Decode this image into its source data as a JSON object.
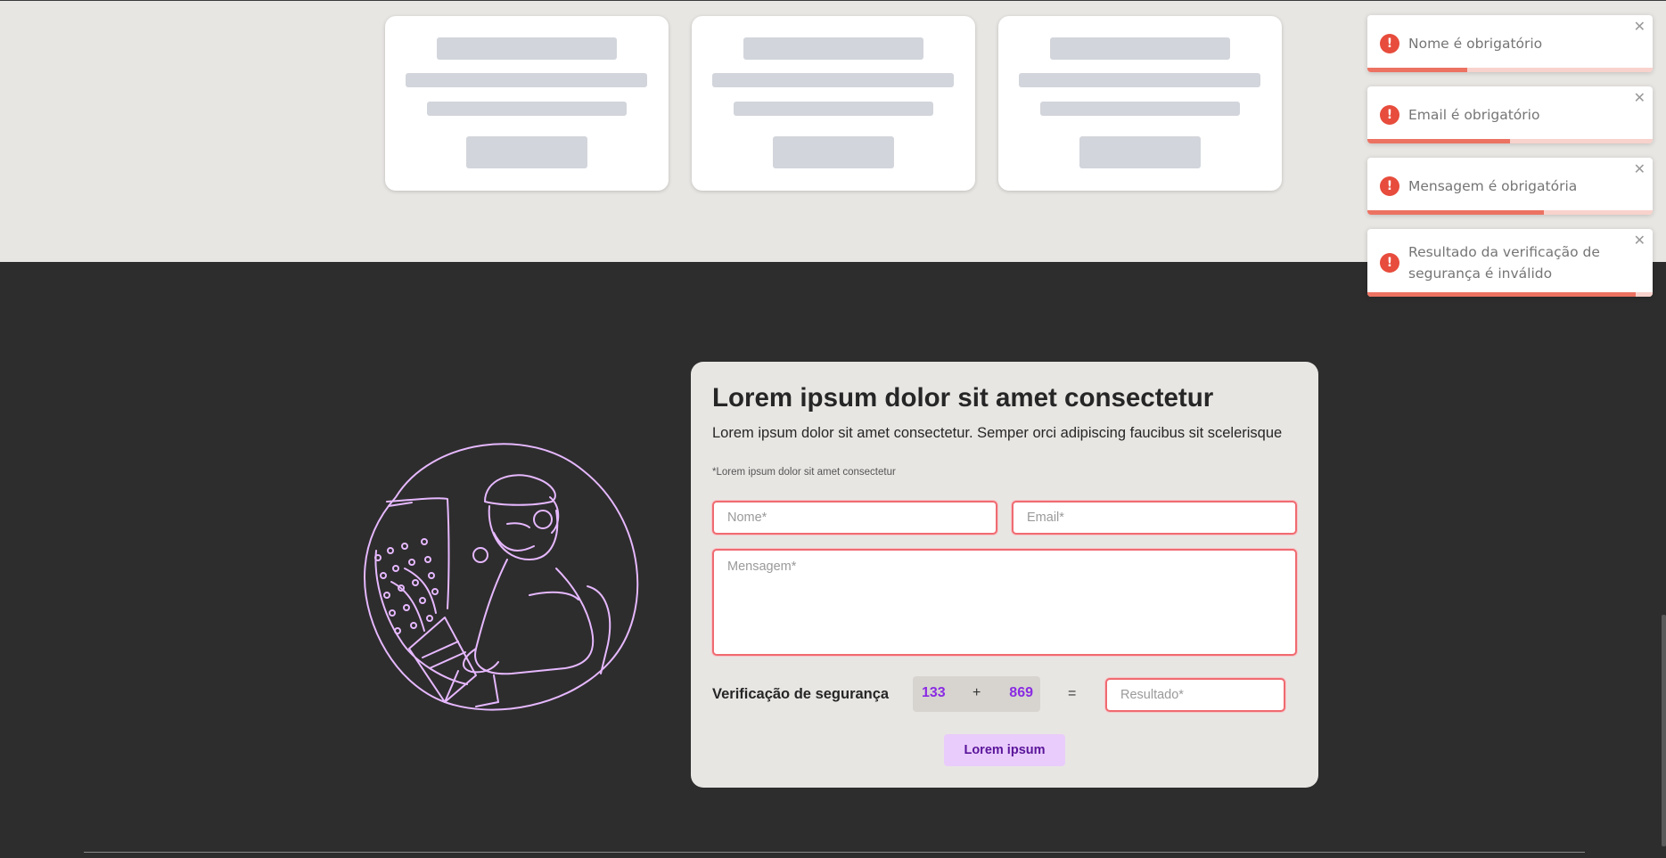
{
  "toasts": [
    {
      "message": "Nome é obrigatório",
      "progress": 0.35
    },
    {
      "message": "Email é obrigatório",
      "progress": 0.5
    },
    {
      "message": "Mensagem é obrigatória",
      "progress": 0.62
    },
    {
      "message": "Resultado da verificação de segurança é inválido",
      "progress": 0.94
    }
  ],
  "toast_icon": "error-exclamation-icon",
  "toast_close_icon": "close-icon",
  "contact": {
    "title": "Lorem ipsum dolor sit amet consectetur",
    "subtitle": "Lorem ipsum dolor sit amet consectetur. Semper orci adipiscing faucibus sit scelerisque",
    "required_note": "*Lorem ipsum dolor sit amet consectetur",
    "fields": {
      "name_placeholder": "Nome*",
      "email_placeholder": "Email*",
      "message_placeholder": "Mensagem*",
      "result_placeholder": "Resultado*"
    },
    "security": {
      "label": "Verificação de segurança",
      "a": "133",
      "op": "+",
      "b": "869",
      "equals": "="
    },
    "submit_label": "Lorem ipsum"
  },
  "colors": {
    "page_dark": "#2d2d2d",
    "section_light": "#e8e6e3",
    "error": "#e74c3c",
    "invalid_border": "#ef6b71",
    "captcha_number": "#8a2be2",
    "button_bg": "#e9ccfb",
    "button_text": "#5a159a",
    "illustration_stroke": "#e6b8ff"
  }
}
